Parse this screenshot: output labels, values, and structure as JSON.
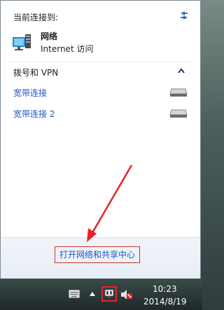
{
  "panel": {
    "header_title": "当前连接到:",
    "network": {
      "name": "网络",
      "status": "Internet 访问"
    },
    "dialup_section": {
      "title": "拨号和 VPN"
    },
    "connections": [
      {
        "label": "宽带连接"
      },
      {
        "label": "宽带连接 2"
      }
    ],
    "footer_link": "打开网络和共享中心"
  },
  "taskbar": {
    "time": "10:23",
    "date": "2014/8/19"
  },
  "colors": {
    "link": "#1a58c4",
    "highlight": "#e8232b"
  }
}
